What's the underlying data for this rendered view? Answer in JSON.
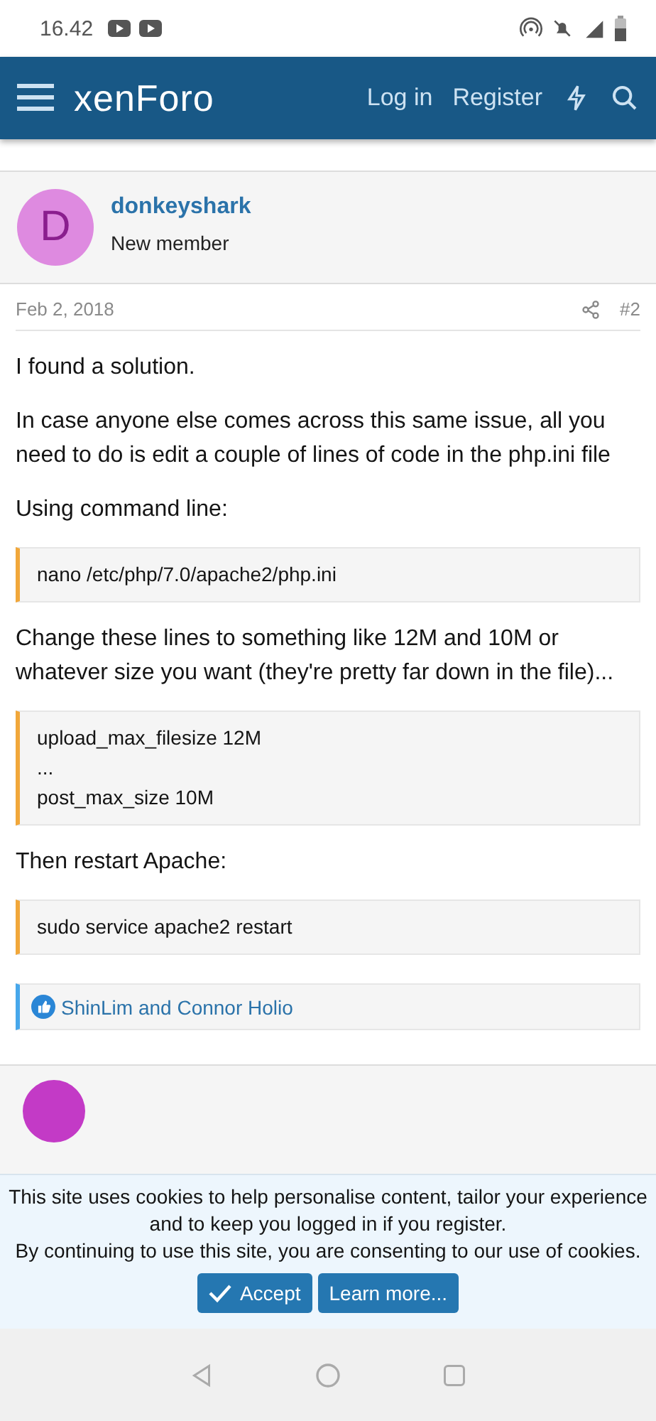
{
  "status_bar": {
    "time": "16.42"
  },
  "header": {
    "logo": "xenForo",
    "links": [
      "Log in",
      "Register"
    ]
  },
  "post": {
    "author": "donkeyshark",
    "role": "New member",
    "avatar_letter": "D",
    "date": "Feb 2, 2018",
    "number": "#2",
    "content": [
      {
        "kind": "text",
        "text": "I found a solution."
      },
      {
        "kind": "text",
        "text": "In case anyone else comes across this same issue, all you need to do is edit a couple of lines of code in the php.ini file"
      },
      {
        "kind": "text",
        "text": "Using command line:"
      },
      {
        "kind": "code",
        "lines": [
          "nano /etc/php/7.0/apache2/php.ini"
        ]
      },
      {
        "kind": "text",
        "text": "Change these lines to something like 12M and 10M or whatever size you want (they're pretty far down in the file)..."
      },
      {
        "kind": "code",
        "lines": [
          "upload_max_filesize 12M",
          "...",
          "post_max_size 10M"
        ]
      },
      {
        "kind": "text",
        "text": "Then restart Apache:"
      },
      {
        "kind": "code",
        "lines": [
          "sudo service apache2 restart"
        ]
      }
    ],
    "reactions": "ShinLim and Connor Holio"
  },
  "cookie_notice": {
    "lines": [
      "This site uses cookies to help personalise content, tailor your experience and to keep you logged in if you register.",
      "By continuing to use this site, you are consenting to our use of cookies."
    ],
    "accept": "Accept",
    "learn_more": "Learn more..."
  }
}
